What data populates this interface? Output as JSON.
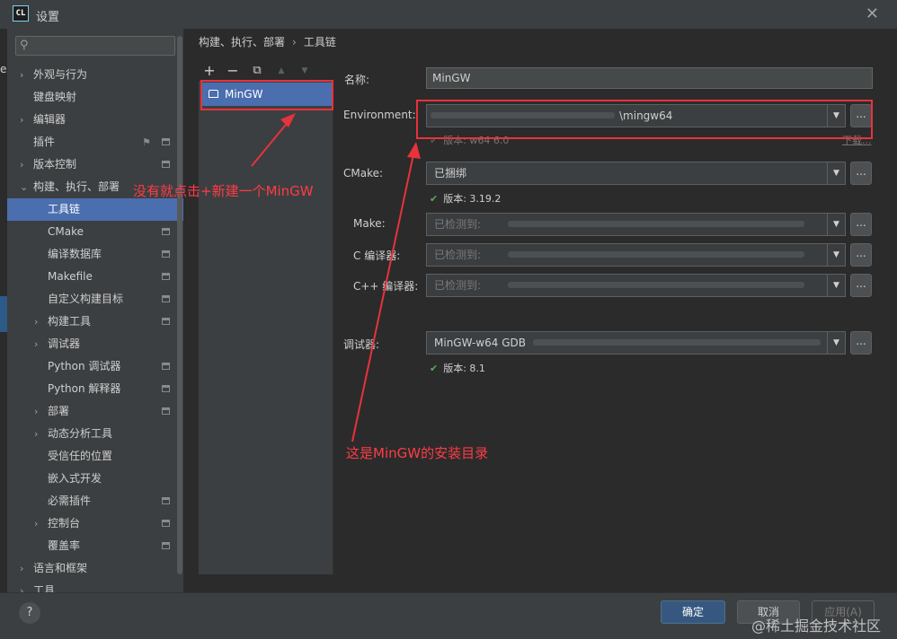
{
  "window": {
    "title": "设置",
    "app_logo": "CL",
    "close_icon": "close-icon"
  },
  "search": {
    "placeholder": "Q",
    "icon": "search-icon"
  },
  "sidebar": {
    "items": [
      {
        "label": "外观与行为",
        "level": 0,
        "expandable": true,
        "selected": false,
        "pinned": false
      },
      {
        "label": "键盘映射",
        "level": 0,
        "expandable": false,
        "selected": false,
        "pinned": false
      },
      {
        "label": "编辑器",
        "level": 0,
        "expandable": true,
        "selected": false,
        "pinned": false
      },
      {
        "label": "插件",
        "level": 0,
        "expandable": false,
        "selected": false,
        "pinned": true
      },
      {
        "label": "版本控制",
        "level": 0,
        "expandable": true,
        "selected": false,
        "pinned": true
      },
      {
        "label": "构建、执行、部署",
        "level": 0,
        "expandable": true,
        "expanded": true,
        "selected": false,
        "pinned": false
      },
      {
        "label": "工具链",
        "level": 1,
        "expandable": false,
        "selected": true,
        "pinned": false
      },
      {
        "label": "CMake",
        "level": 1,
        "expandable": false,
        "selected": false,
        "pinned": true
      },
      {
        "label": "编译数据库",
        "level": 1,
        "expandable": false,
        "selected": false,
        "pinned": true
      },
      {
        "label": "Makefile",
        "level": 1,
        "expandable": false,
        "selected": false,
        "pinned": true
      },
      {
        "label": "自定义构建目标",
        "level": 1,
        "expandable": false,
        "selected": false,
        "pinned": true
      },
      {
        "label": "构建工具",
        "level": 1,
        "expandable": true,
        "selected": false,
        "pinned": true
      },
      {
        "label": "调试器",
        "level": 1,
        "expandable": true,
        "selected": false,
        "pinned": false
      },
      {
        "label": "Python 调试器",
        "level": 1,
        "expandable": false,
        "selected": false,
        "pinned": true
      },
      {
        "label": "Python 解释器",
        "level": 1,
        "expandable": false,
        "selected": false,
        "pinned": true
      },
      {
        "label": "部署",
        "level": 1,
        "expandable": true,
        "selected": false,
        "pinned": true
      },
      {
        "label": "动态分析工具",
        "level": 1,
        "expandable": true,
        "selected": false,
        "pinned": false
      },
      {
        "label": "受信任的位置",
        "level": 1,
        "expandable": false,
        "selected": false,
        "pinned": false
      },
      {
        "label": "嵌入式开发",
        "level": 1,
        "expandable": false,
        "selected": false,
        "pinned": false
      },
      {
        "label": "必需插件",
        "level": 1,
        "expandable": false,
        "selected": false,
        "pinned": true
      },
      {
        "label": "控制台",
        "level": 1,
        "expandable": true,
        "selected": false,
        "pinned": true
      },
      {
        "label": "覆盖率",
        "level": 1,
        "expandable": false,
        "selected": false,
        "pinned": true
      },
      {
        "label": "语言和框架",
        "level": 0,
        "expandable": true,
        "selected": false,
        "pinned": false
      },
      {
        "label": "工具",
        "level": 0,
        "expandable": true,
        "selected": false,
        "pinned": false
      }
    ]
  },
  "breadcrumb": {
    "parent": "构建、执行、部署",
    "separator": "›",
    "current": "工具链"
  },
  "toolbar": {
    "add": "+",
    "remove": "−",
    "copy": "⧉",
    "up": "▲",
    "down": "▼"
  },
  "toolchains": [
    {
      "name": "MinGW"
    }
  ],
  "form": {
    "name_label": "名称:",
    "name_value": "MinGW",
    "environment_label": "Environment:",
    "environment_value": "\\mingw64",
    "environment_version": "版本: w64 6.0",
    "environment_download": "下载...",
    "cmake_label": "CMake:",
    "cmake_value": "已捆绑",
    "cmake_version": "版本: 3.19.2",
    "make_label": "Make:",
    "make_value": "已检测到:",
    "c_compiler_label": "C 编译器:",
    "c_compiler_value": "已检测到:",
    "cpp_compiler_label": "C++ 编译器:",
    "cpp_compiler_value": "已检测到:",
    "debugger_label": "调试器:",
    "debugger_value": "MinGW-w64 GDB",
    "debugger_version": "版本: 8.1",
    "browse": "..."
  },
  "annotations": {
    "new_hint": "没有就点击+新建一个MinGW",
    "dir_hint": "这是MinGW的安装目录",
    "color": "#e8323c"
  },
  "footer": {
    "help": "?",
    "ok": "确定",
    "cancel": "取消",
    "apply": "应用(A)"
  },
  "watermark": "@稀土掘金技术社区"
}
